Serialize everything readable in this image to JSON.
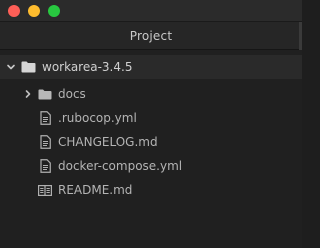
{
  "window": {
    "title": "Project",
    "controls": [
      "close",
      "minimize",
      "maximize"
    ]
  },
  "tree": {
    "root": {
      "label": "workarea-3.4.5",
      "expanded": true,
      "icon": "folder-icon"
    },
    "items": [
      {
        "label": "docs",
        "type": "folder",
        "expanded": false,
        "icon": "folder-icon"
      },
      {
        "label": ".rubocop.yml",
        "type": "file",
        "icon": "file-icon"
      },
      {
        "label": "CHANGELOG.md",
        "type": "file",
        "icon": "file-icon"
      },
      {
        "label": "docker-compose.yml",
        "type": "file",
        "icon": "file-icon"
      },
      {
        "label": "README.md",
        "type": "file",
        "icon": "book-icon"
      }
    ]
  }
}
